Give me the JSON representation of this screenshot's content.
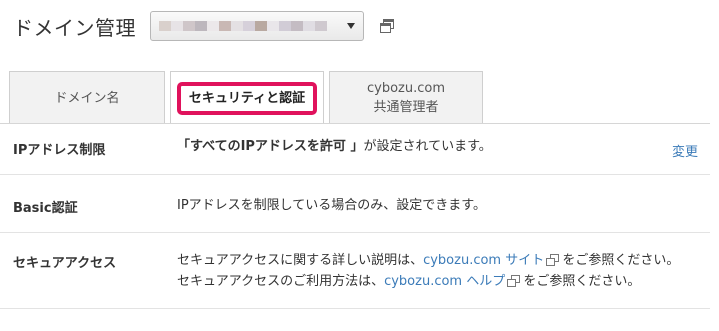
{
  "header": {
    "title": "ドメイン管理",
    "domain_select": {
      "selected_value": "",
      "blur_colors": [
        "#d9d0cc",
        "#e7e3e6",
        "#cfc6c9",
        "#bdb7bd",
        "#ece8ea",
        "#c9b8b4",
        "#e4e0e3",
        "#d6d0da",
        "#b9a9a1",
        "#e9e6ea",
        "#d1ccd6",
        "#c4bcc3",
        "#e0dde3",
        "#cfc9cf"
      ]
    }
  },
  "tabs": [
    {
      "label": "ドメイン名",
      "label2": "",
      "selected": false
    },
    {
      "label": "セキュリティと認証",
      "label2": "",
      "selected": true
    },
    {
      "label": "cybozu.com",
      "label2": "共通管理者",
      "selected": false
    }
  ],
  "rows": {
    "ip": {
      "label": "IPアドレス制限",
      "value_bold": "「すべてのIPアドレスを許可 」",
      "value_rest": "が設定されています。",
      "action": "変更"
    },
    "basic": {
      "label": "Basic認証",
      "value": "IPアドレスを制限している場合のみ、設定できます。"
    },
    "secure": {
      "label": "セキュアアクセス",
      "line1_pre": "セキュアアクセスに関する詳しい説明は、",
      "line1_link": "cybozu.com サイト",
      "line1_post": "をご参照ください。",
      "line2_pre": "セキュアアクセスのご利用方法は、",
      "line2_link": "cybozu.com ヘルプ",
      "line2_post": "をご参照ください。"
    }
  },
  "colors": {
    "highlight": "#e0125c",
    "link": "#3b7bb8"
  }
}
